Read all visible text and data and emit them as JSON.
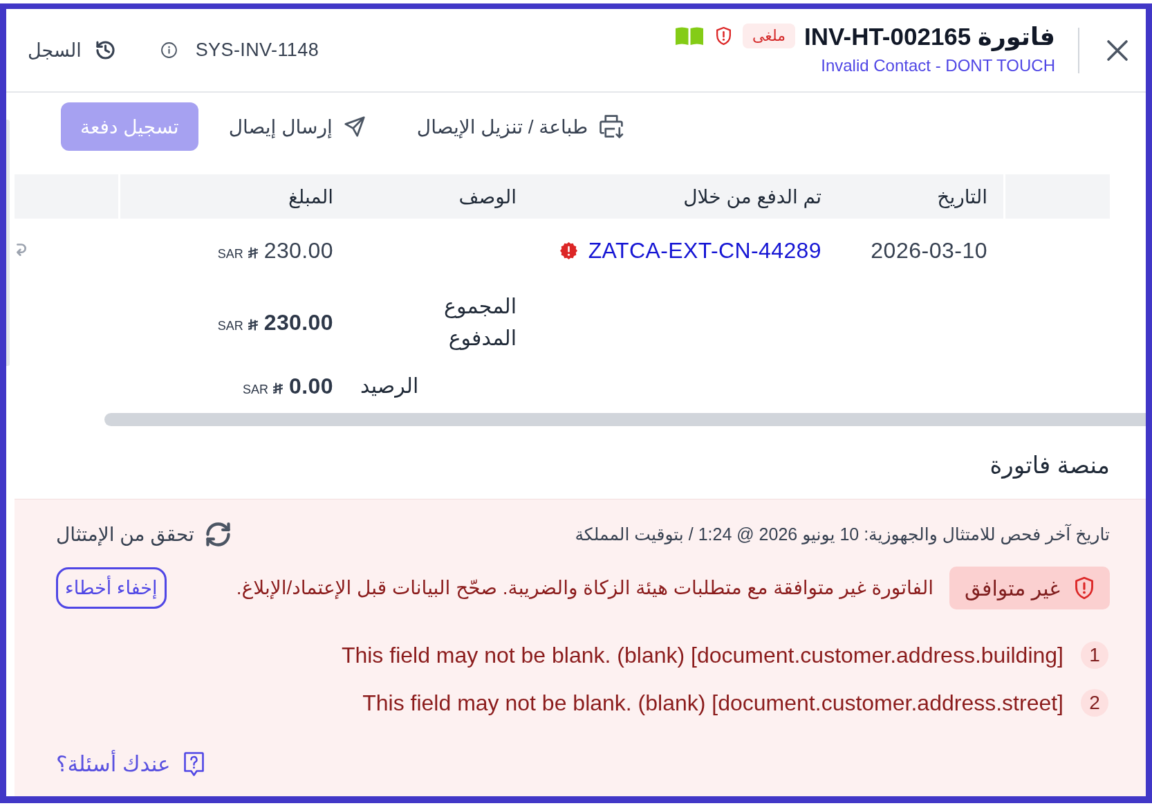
{
  "header": {
    "title": "فاتورة INV-HT-002165",
    "status_badge": "ملغى",
    "contact_link": "Invalid Contact - DONT TOUCH",
    "history_button": "السجل",
    "system_id": "SYS-INV-1148"
  },
  "actions": [
    {
      "kind": "print",
      "label": "طباعة / تنزيل الإيصال"
    },
    {
      "kind": "send",
      "label": "إرسال إيصال"
    },
    {
      "kind": "primary",
      "label": "تسجيل دفعة"
    }
  ],
  "payments_table": {
    "columns": [
      "التاريخ",
      "تم الدفع من خلال",
      "الوصف",
      "المبلغ"
    ],
    "rows": [
      {
        "date": "2026-03-10",
        "paid_via": "ZATCA-EXT-CN-44289",
        "amount": "230.00",
        "currency": "SAR"
      }
    ],
    "totals": [
      {
        "kind": "paid",
        "label": "المجموع المدفوع",
        "amount": "230.00",
        "currency": "SAR"
      },
      {
        "kind": "balance",
        "label": "الرصيد",
        "amount": "0.00",
        "currency": "SAR"
      }
    ]
  },
  "fatoora_platform": {
    "title": "منصة فاتورة",
    "last_check": "تاريخ آخر فحص للامتثال والجهوزية: 10 يونيو 2026 @ 1:24 / بتوقيت المملكة",
    "verify_button": "تحقق من الإمتثال",
    "status_badge": "غير متوافق",
    "message": "الفاتورة غير متوافقة مع متطلبات هيئة الزكاة والضريبة. صحّح البيانات قبل الإعتماد/الإبلاغ.",
    "hide_errors_button": "إخفاء أخطاء",
    "errors": [
      {
        "number": "1",
        "text": "This field may not be blank. (blank) [document.customer.address.building]"
      },
      {
        "number": "2",
        "text": "This field may not be blank. (blank) [document.customer.address.street]"
      }
    ],
    "help_link": "عندك أسئلة؟"
  }
}
